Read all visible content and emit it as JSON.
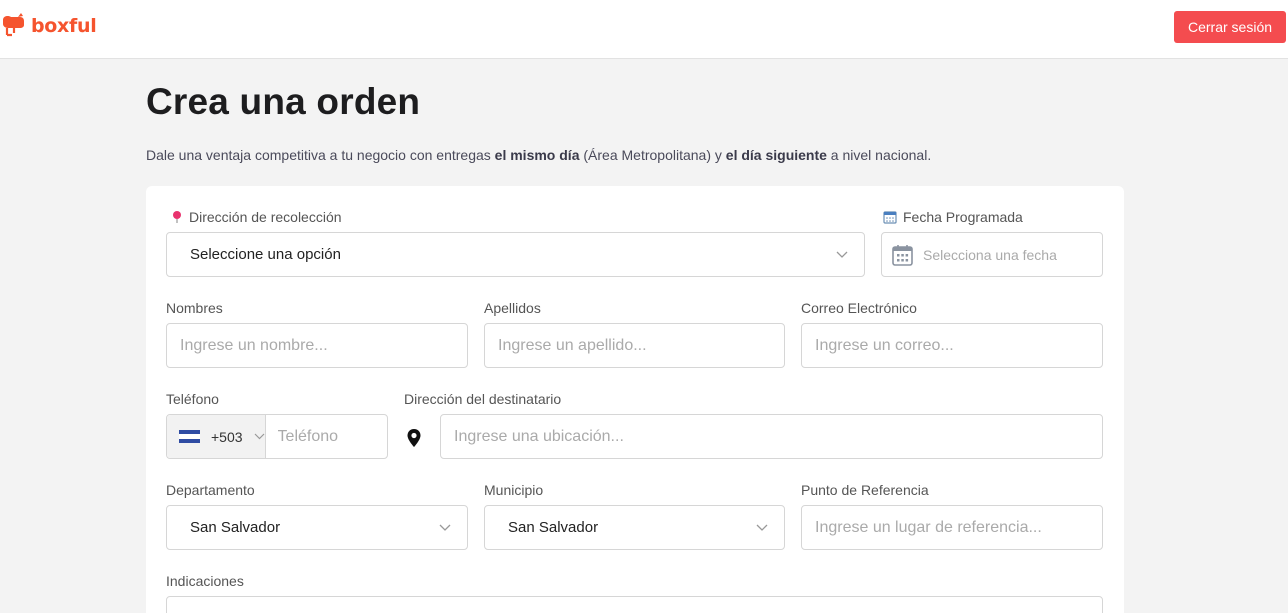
{
  "header": {
    "brand": "boxful",
    "logout_label": "Cerrar sesión",
    "accent_color": "#f5542e",
    "logout_color": "#f44c4f"
  },
  "page": {
    "title": "Crea una orden",
    "intro": {
      "part1": "Dale una ventaja competitiva a tu negocio con entregas ",
      "bold1": "el mismo día",
      "part2": " (Área Metropolitana) y ",
      "bold2": "el día siguiente",
      "part3": " a nivel nacional."
    }
  },
  "form": {
    "pickup": {
      "label": "Dirección de recolección",
      "value": "Seleccione una opción",
      "icon": "map-pin-icon"
    },
    "date": {
      "label": "Fecha Programada",
      "placeholder": "Selecciona una fecha",
      "icon": "calendar-icon"
    },
    "first_name": {
      "label": "Nombres",
      "placeholder": "Ingrese un nombre..."
    },
    "last_name": {
      "label": "Apellidos",
      "placeholder": "Ingrese un apellido..."
    },
    "email": {
      "label": "Correo Electrónico",
      "placeholder": "Ingrese un correo..."
    },
    "phone": {
      "label": "Teléfono",
      "code": "+503",
      "placeholder": "Teléfono"
    },
    "address": {
      "label": "Dirección del destinatario",
      "placeholder": "Ingrese una ubicación..."
    },
    "department": {
      "label": "Departamento",
      "value": "San Salvador"
    },
    "municipality": {
      "label": "Municipio",
      "value": "San Salvador"
    },
    "reference": {
      "label": "Punto de Referencia",
      "placeholder": "Ingrese un lugar de referencia..."
    },
    "instructions": {
      "label": "Indicaciones"
    }
  }
}
